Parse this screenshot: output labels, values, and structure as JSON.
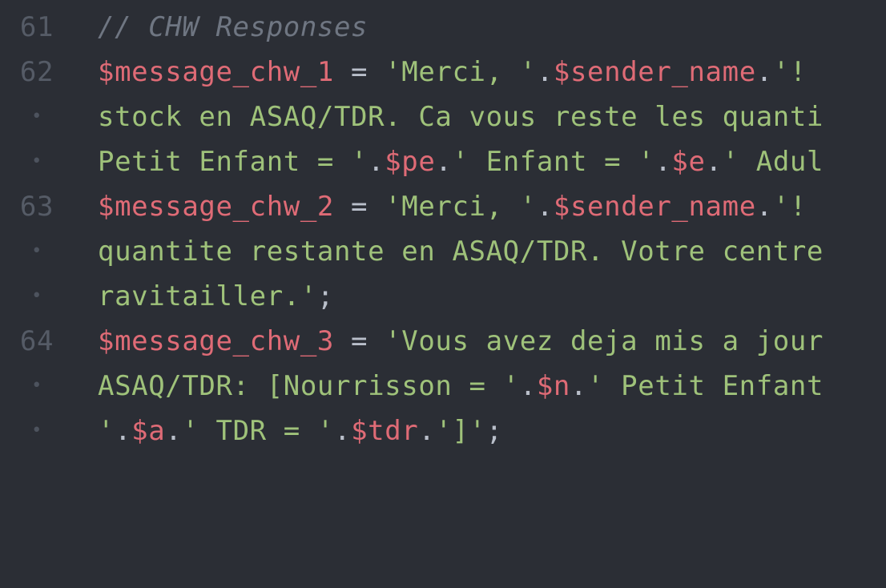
{
  "editor": {
    "lines": [
      {
        "gutter": "61",
        "tokens": [
          {
            "t": "comment",
            "v": "// CHW Responses"
          }
        ]
      },
      {
        "gutter": "62",
        "tokens": [
          {
            "t": "var",
            "v": "$message_chw_1"
          },
          {
            "t": "op",
            "v": " = "
          },
          {
            "t": "str",
            "v": "'Merci, '"
          },
          {
            "t": "op",
            "v": "."
          },
          {
            "t": "var",
            "v": "$sender_name"
          },
          {
            "t": "op",
            "v": "."
          },
          {
            "t": "str",
            "v": "'!"
          }
        ]
      },
      {
        "gutter": "•",
        "tokens": [
          {
            "t": "str",
            "v": "stock en ASAQ/TDR. Ca vous reste les quanti"
          }
        ]
      },
      {
        "gutter": "•",
        "tokens": [
          {
            "t": "str",
            "v": "Petit Enfant = '"
          },
          {
            "t": "op",
            "v": "."
          },
          {
            "t": "var",
            "v": "$pe"
          },
          {
            "t": "op",
            "v": "."
          },
          {
            "t": "str",
            "v": "' Enfant = '"
          },
          {
            "t": "op",
            "v": "."
          },
          {
            "t": "var",
            "v": "$e"
          },
          {
            "t": "op",
            "v": "."
          },
          {
            "t": "str",
            "v": "' Adul"
          }
        ]
      },
      {
        "gutter": "63",
        "tokens": [
          {
            "t": "var",
            "v": "$message_chw_2"
          },
          {
            "t": "op",
            "v": " = "
          },
          {
            "t": "str",
            "v": "'Merci, '"
          },
          {
            "t": "op",
            "v": "."
          },
          {
            "t": "var",
            "v": "$sender_name"
          },
          {
            "t": "op",
            "v": "."
          },
          {
            "t": "str",
            "v": "'!"
          }
        ]
      },
      {
        "gutter": "•",
        "tokens": [
          {
            "t": "str",
            "v": "quantite restante en ASAQ/TDR. Votre centre"
          }
        ]
      },
      {
        "gutter": "•",
        "tokens": [
          {
            "t": "str",
            "v": "ravitailler.'"
          },
          {
            "t": "op",
            "v": ";"
          }
        ]
      },
      {
        "gutter": "64",
        "tokens": [
          {
            "t": "var",
            "v": "$message_chw_3"
          },
          {
            "t": "op",
            "v": " = "
          },
          {
            "t": "str",
            "v": "'Vous avez deja mis a jour"
          }
        ]
      },
      {
        "gutter": "•",
        "tokens": [
          {
            "t": "str",
            "v": "ASAQ/TDR: [Nourrisson = '"
          },
          {
            "t": "op",
            "v": "."
          },
          {
            "t": "var",
            "v": "$n"
          },
          {
            "t": "op",
            "v": "."
          },
          {
            "t": "str",
            "v": "' Petit Enfant"
          }
        ]
      },
      {
        "gutter": "•",
        "tokens": [
          {
            "t": "str",
            "v": "'"
          },
          {
            "t": "op",
            "v": "."
          },
          {
            "t": "var",
            "v": "$a"
          },
          {
            "t": "op",
            "v": "."
          },
          {
            "t": "str",
            "v": "' TDR = '"
          },
          {
            "t": "op",
            "v": "."
          },
          {
            "t": "var",
            "v": "$tdr"
          },
          {
            "t": "op",
            "v": "."
          },
          {
            "t": "str",
            "v": "']'"
          },
          {
            "t": "op",
            "v": ";"
          }
        ]
      }
    ]
  },
  "colors": {
    "background": "#2b2e35",
    "gutter_text": "#555b66",
    "comment": "#6f7682",
    "variable": "#df6b76",
    "string": "#9fc27a",
    "operator": "#b9bfca"
  }
}
